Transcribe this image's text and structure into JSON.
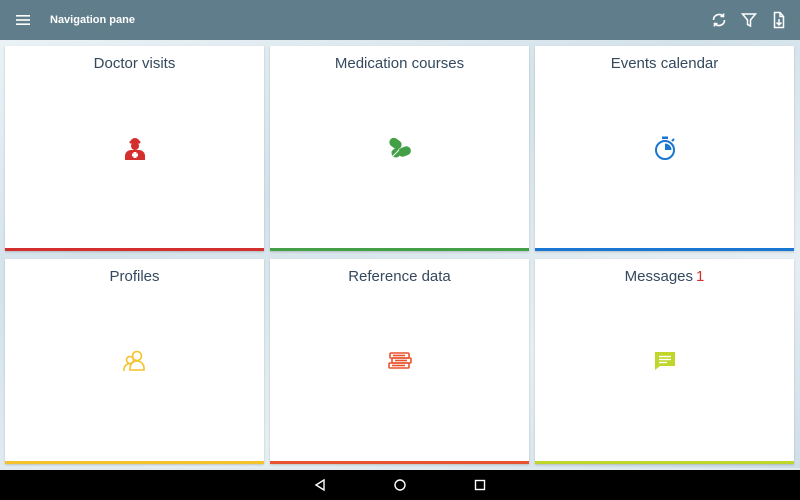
{
  "appbar": {
    "title": "Navigation pane",
    "icons": [
      "menu-icon",
      "sync-icon",
      "filter-icon",
      "export-icon"
    ],
    "background": "#607d8b"
  },
  "tiles": [
    {
      "label": "Doctor visits",
      "icon": "doctor-icon",
      "color": "#d32f2f"
    },
    {
      "label": "Medication courses",
      "icon": "pills-icon",
      "color": "#43a047"
    },
    {
      "label": "Events calendar",
      "icon": "stopwatch-icon",
      "color": "#1976d2"
    },
    {
      "label": "Profiles",
      "icon": "profiles-icon",
      "color": "#f4c22b"
    },
    {
      "label": "Reference data",
      "icon": "books-icon",
      "color": "#e8542f"
    },
    {
      "label": "Messages",
      "badge": "1",
      "icon": "message-icon",
      "color": "#c0d62b"
    }
  ],
  "system_nav": {
    "icons": [
      "back-icon",
      "home-icon",
      "recents-icon"
    ]
  }
}
